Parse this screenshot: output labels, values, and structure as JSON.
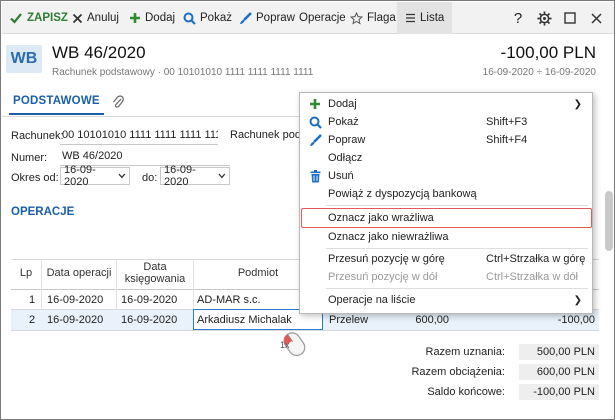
{
  "toolbar": {
    "save": "ZAPISZ",
    "cancel": "Anuluj",
    "add": "Dodaj",
    "show": "Pokaż",
    "edit": "Popraw",
    "operations": "Operacje",
    "flag": "Flaga",
    "list": "Lista",
    "help": "?"
  },
  "header": {
    "badge": "WB",
    "title": "WB 46/2020",
    "subtitle": "Rachunek podstawowy · 00 10101010 1111 1111 1111 1111",
    "amount": "-100,00 PLN",
    "dates": "16-09-2020 ÷ 16-09-2020"
  },
  "tabs": {
    "main": "PODSTAWOWE"
  },
  "form": {
    "account_label": "Rachunek:",
    "account_value": "00 10101010 1111 1111 1111 1111",
    "account_name": "Rachunek podst",
    "number_label": "Numer:",
    "number_value": "WB 46/2020",
    "period_label": "Okres od:",
    "period_from": "16-09-2020",
    "period_to_label": "do:",
    "period_to": "16-09-2020"
  },
  "section": {
    "operations_title": "OPERACJE"
  },
  "table": {
    "headers": {
      "lp": "Lp",
      "date_op": "Data operacji",
      "date_book": "Data księgowania",
      "subject": "Podmiot"
    },
    "rows": [
      {
        "lp": "1",
        "date_op": "16-09-2020",
        "date_book": "16-09-2020",
        "subject": "AD-MAR s.c.",
        "type": "",
        "amount1": "",
        "amount2": ""
      },
      {
        "lp": "2",
        "date_op": "16-09-2020",
        "date_book": "16-09-2020",
        "subject": "Arkadiusz Michalak",
        "type": "Przelew",
        "amount1": "600,00",
        "amount2": "-100,00"
      }
    ]
  },
  "totals": {
    "credit_label": "Razem uznania:",
    "credit_value": "500,00 PLN",
    "debit_label": "Razem obciążenia:",
    "debit_value": "600,00 PLN",
    "balance_label": "Saldo końcowe:",
    "balance_value": "-100,00 PLN"
  },
  "context_menu": {
    "add": "Dodaj",
    "show": "Pokaż",
    "show_shortcut": "Shift+F3",
    "edit": "Popraw",
    "edit_shortcut": "Shift+F4",
    "detach": "Odłącz",
    "delete": "Usuń",
    "link": "Powiąż z dyspozycją bankową",
    "mark_sensitive": "Oznacz jako wrażliwa",
    "mark_insensitive": "Oznacz jako niewrażliwa",
    "move_up": "Przesuń pozycję w górę",
    "move_up_shortcut": "Ctrl+Strzałka w górę",
    "move_down": "Przesuń pozycję w dół",
    "move_down_shortcut": "Ctrl+Strzałka w dół",
    "list_ops": "Operacje na liście"
  },
  "mouse": {
    "clicks": "1x"
  },
  "colors": {
    "accent": "#1a5fa8",
    "save_green": "#2e7d32",
    "highlight": "#e05a5a"
  }
}
